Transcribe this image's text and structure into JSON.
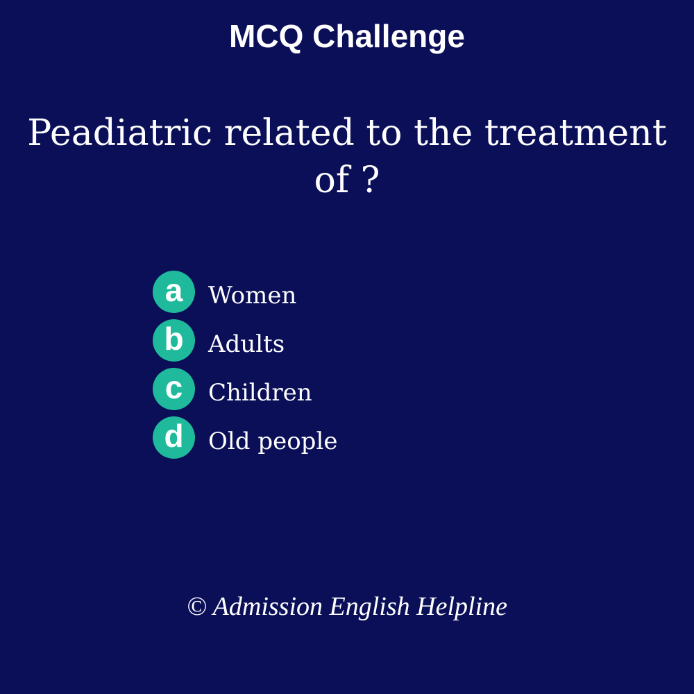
{
  "header": {
    "title": "MCQ Challenge"
  },
  "question": {
    "text": "Peadiatric related to the treatment of ?"
  },
  "options": [
    {
      "letter": "a",
      "text": "Women"
    },
    {
      "letter": "b",
      "text": "Adults"
    },
    {
      "letter": "c",
      "text": "Children"
    },
    {
      "letter": "d",
      "text": "Old people"
    }
  ],
  "footer": {
    "credit": "© Admission English Helpline"
  },
  "colors": {
    "background": "#0a0f58",
    "badge": "#1fba9b",
    "text": "#ffffff"
  }
}
